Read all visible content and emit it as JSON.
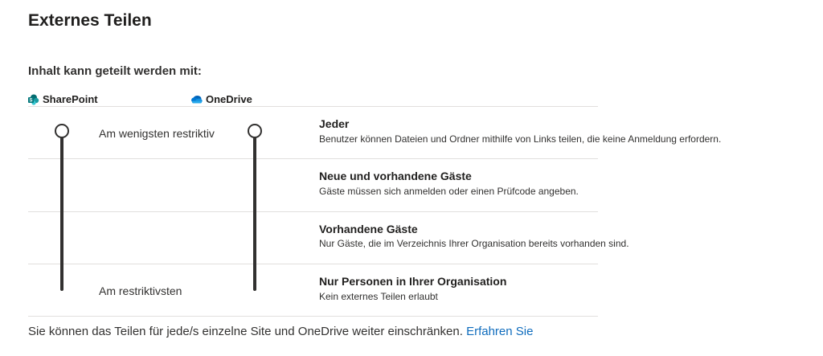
{
  "page": {
    "title": "Externes Teilen"
  },
  "sharing": {
    "heading": "Inhalt kann geteilt werden mit:",
    "sharepoint": {
      "label": "SharePoint",
      "icon": "sharepoint-icon",
      "color": "#038387",
      "level_index": 0,
      "level_label": "Jeder"
    },
    "onedrive": {
      "label": "OneDrive",
      "icon": "onedrive-icon",
      "color": "#0364b8",
      "level_index": 0,
      "level_label": "Jeder"
    },
    "range": {
      "top_label": "Am wenigsten restriktiv",
      "bottom_label": "Am restriktivsten"
    },
    "levels": [
      {
        "title": "Jeder",
        "description": "Benutzer können Dateien und Ordner mithilfe von Links teilen, die keine Anmeldung erfordern."
      },
      {
        "title": "Neue und vorhandene Gäste",
        "description": "Gäste müssen sich anmelden oder einen Prüfcode angeben."
      },
      {
        "title": "Vorhandene Gäste",
        "description": "Nur Gäste, die im Verzeichnis Ihrer Organisation bereits vorhanden sind."
      },
      {
        "title": "Nur Personen in Ihrer Organisation",
        "description": "Kein externes Teilen erlaubt"
      }
    ]
  },
  "footer": {
    "text": "Sie können das Teilen für jede/s einzelne Site und OneDrive weiter einschränken.",
    "link_label": "Erfahren Sie"
  }
}
